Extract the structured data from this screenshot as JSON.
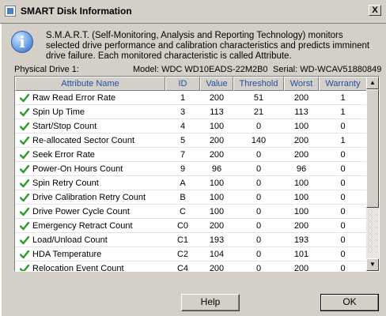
{
  "window": {
    "title": "SMART Disk Information",
    "close_glyph": "X"
  },
  "info": {
    "icon": "info-icon",
    "text": "S.M.A.R.T. (Self-Monitoring, Analysis and Reporting Technology) monitors selected drive performance and calibration characteristics and predicts imminent drive failure. Each monitored characteristic is called Attribute."
  },
  "drive": {
    "physical": "Physical Drive 1:",
    "model": "Model: WDC WD10EADS-22M2B0",
    "serial": "Serial: WD-WCAV51880849"
  },
  "table": {
    "headers": [
      "Attribute Name",
      "ID",
      "Value",
      "Threshold",
      "Worst",
      "Warranty"
    ],
    "rows": [
      {
        "name": "Raw Read Error Rate",
        "id": "1",
        "value": "200",
        "threshold": "51",
        "worst": "200",
        "warranty": "1"
      },
      {
        "name": "Spin Up Time",
        "id": "3",
        "value": "113",
        "threshold": "21",
        "worst": "113",
        "warranty": "1"
      },
      {
        "name": "Start/Stop Count",
        "id": "4",
        "value": "100",
        "threshold": "0",
        "worst": "100",
        "warranty": "0"
      },
      {
        "name": "Re-allocated Sector Count",
        "id": "5",
        "value": "200",
        "threshold": "140",
        "worst": "200",
        "warranty": "1"
      },
      {
        "name": "Seek Error Rate",
        "id": "7",
        "value": "200",
        "threshold": "0",
        "worst": "200",
        "warranty": "0"
      },
      {
        "name": "Power-On Hours Count",
        "id": "9",
        "value": "96",
        "threshold": "0",
        "worst": "96",
        "warranty": "0"
      },
      {
        "name": "Spin Retry Count",
        "id": "A",
        "value": "100",
        "threshold": "0",
        "worst": "100",
        "warranty": "0"
      },
      {
        "name": "Drive Calibration Retry Count",
        "id": "B",
        "value": "100",
        "threshold": "0",
        "worst": "100",
        "warranty": "0"
      },
      {
        "name": "Drive Power Cycle Count",
        "id": "C",
        "value": "100",
        "threshold": "0",
        "worst": "100",
        "warranty": "0"
      },
      {
        "name": "Emergency Retract Count",
        "id": "C0",
        "value": "200",
        "threshold": "0",
        "worst": "200",
        "warranty": "0"
      },
      {
        "name": "Load/Unload Count",
        "id": "C1",
        "value": "193",
        "threshold": "0",
        "worst": "193",
        "warranty": "0"
      },
      {
        "name": "HDA Temperature",
        "id": "C2",
        "value": "104",
        "threshold": "0",
        "worst": "101",
        "warranty": "0"
      },
      {
        "name": "Relocation Event Count",
        "id": "C4",
        "value": "200",
        "threshold": "0",
        "worst": "200",
        "warranty": "0"
      }
    ],
    "status_icon": "check-icon",
    "status_color": "#2e9a2e"
  },
  "buttons": {
    "help": "Help",
    "ok": "OK"
  }
}
